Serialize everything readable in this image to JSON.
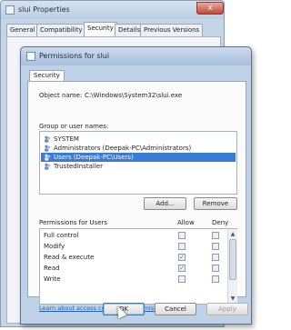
{
  "back_window": {
    "title": "slui Properties",
    "close_symbol": "x",
    "tabs": [
      {
        "label": "General",
        "active": false
      },
      {
        "label": "Compatibility",
        "active": false
      },
      {
        "label": "Security",
        "active": true
      },
      {
        "label": "Details",
        "active": false
      },
      {
        "label": "Previous Versions",
        "active": false
      }
    ]
  },
  "dialog": {
    "title": "Permissions for slui",
    "tab_label": "Security",
    "object_name_label": "Object name:",
    "object_name_value": "C:\\Windows\\System32\\slui.exe",
    "group_label": "Group or user names:",
    "groups": [
      {
        "name": "SYSTEM",
        "selected": false
      },
      {
        "name": "Administrators (Deepak-PC\\Administrators)",
        "selected": false
      },
      {
        "name": "Users (Deepak-PC\\Users)",
        "selected": true
      },
      {
        "name": "TrustedInstaller",
        "selected": false
      }
    ],
    "add_button": "Add...",
    "remove_button": "Remove",
    "permissions_label": "Permissions for Users",
    "allow_header": "Allow",
    "deny_header": "Deny",
    "permissions": [
      {
        "name": "Full control",
        "allow": false,
        "deny": false
      },
      {
        "name": "Modify",
        "allow": false,
        "deny": false
      },
      {
        "name": "Read & execute",
        "allow": true,
        "deny": false
      },
      {
        "name": "Read",
        "allow": true,
        "deny": false
      },
      {
        "name": "Write",
        "allow": false,
        "deny": false
      }
    ],
    "learn_link": "Learn about access control and permissions",
    "ok_button": "OK",
    "cancel_button": "Cancel",
    "apply_button": "Apply"
  },
  "colors": {
    "selection": "#3a7bd5",
    "link": "#1f5fbf",
    "dialog_frame": "#bfd1e7"
  },
  "icons": {
    "window": "app-icon",
    "user": "users-group-icon",
    "close": "close-icon",
    "pointer": "mouse-cursor-icon"
  }
}
